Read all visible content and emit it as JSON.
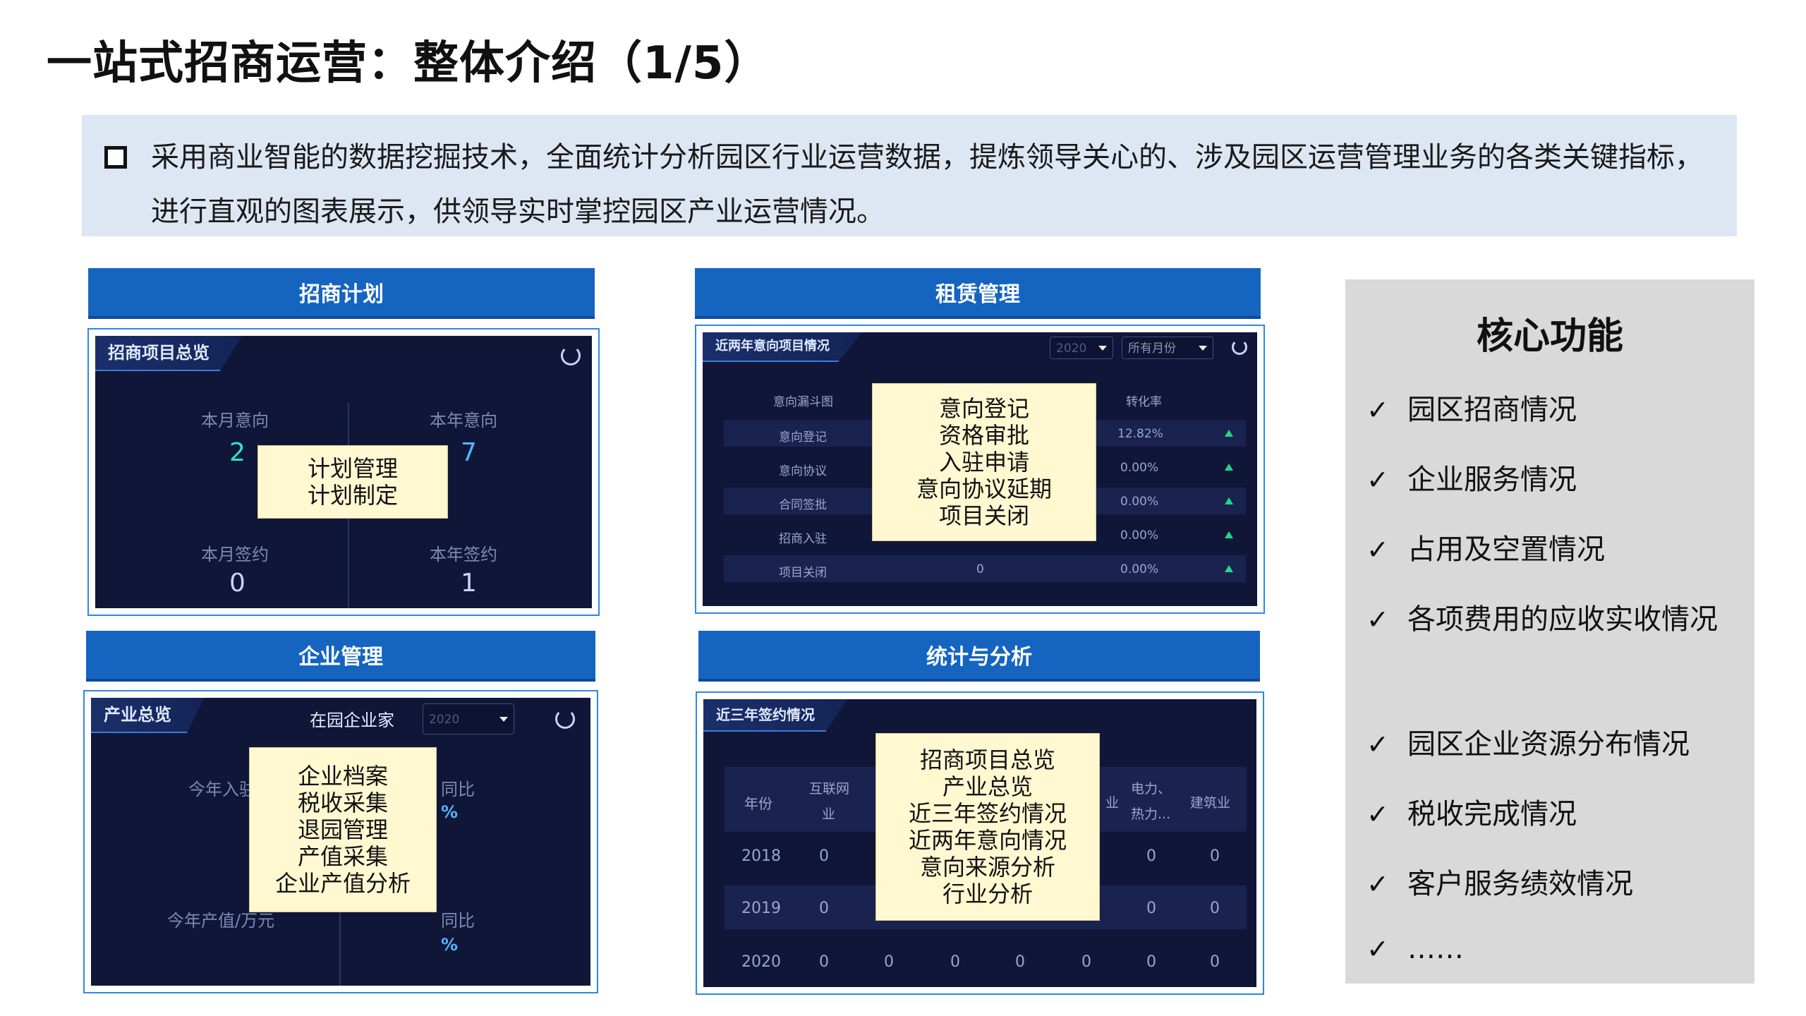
{
  "slide": {
    "title": "一站式招商运营：整体介绍（1/5）",
    "intro": "采用商业智能的数据挖掘技术，全面统计分析园区行业运营数据，提炼领导关心的、涉及园区运营管理业务的各类关键指标，进行直观的图表展示，供领导实时掌控园区产业运营情况。"
  },
  "panels": {
    "plan": {
      "header": "招商计划",
      "tab": "招商项目总览",
      "stats": [
        {
          "label": "本月意向",
          "value": "2",
          "color": "#34e0c8"
        },
        {
          "label": "本年意向",
          "value": "7",
          "color": "#4fb6ff"
        },
        {
          "label": "本月签约",
          "value": "0",
          "color": "#c9d3f0"
        },
        {
          "label": "本年签约",
          "value": "1",
          "color": "#c9d3f0"
        }
      ],
      "overlay": [
        "计划管理",
        "计划制定"
      ]
    },
    "lease": {
      "header": "租赁管理",
      "tab": "近两年意向项目情况",
      "year_select": "2020",
      "month_select": "所有月份",
      "col_funnel": "意向漏斗图",
      "col_rate": "转化率",
      "rows": [
        {
          "name": "意向登记",
          "rate": "12.82%"
        },
        {
          "name": "意向协议",
          "rate": "0.00%"
        },
        {
          "name": "合同签批",
          "rate": "0.00%"
        },
        {
          "name": "招商入驻",
          "count": "0",
          "rate": "0.00%"
        },
        {
          "name": "项目关闭",
          "count": "0",
          "rate": "0.00%"
        }
      ],
      "overlay": [
        "意向登记",
        "资格审批",
        "入驻申请",
        "意向协议延期",
        "项目关闭"
      ]
    },
    "enterprise": {
      "header": "企业管理",
      "tab": "产业总览",
      "filter_label": "在园企业家",
      "year_select": "2020",
      "label_entry": "今年入驻",
      "label_yoy1": "同比",
      "label_output": "今年产值/万元",
      "label_yoy2": "同比",
      "pct1": "%",
      "pct2": "%",
      "overlay": [
        "企业档案",
        "税收采集",
        "退园管理",
        "产值采集",
        "企业产值分析"
      ]
    },
    "stats": {
      "header": "统计与分析",
      "tab": "近三年签约情况",
      "col_year": "年份",
      "col_internet": [
        "互联网",
        "业"
      ],
      "col_partial": "业",
      "col_power": [
        "电力、",
        "热力..."
      ],
      "col_build": "建筑业",
      "rows": [
        {
          "year": "2018",
          "v1": "0",
          "v_end1": "0",
          "v_end2": "0"
        },
        {
          "year": "2019",
          "v1": "0",
          "v_end1": "0",
          "v_end2": "0"
        },
        {
          "year": "2020",
          "values": [
            "0",
            "0",
            "0",
            "0",
            "0",
            "0",
            "0"
          ]
        }
      ],
      "overlay": [
        "招商项目总览",
        "产业总览",
        "近三年签约情况",
        "近两年意向情况",
        "意向来源分析",
        "行业分析"
      ]
    }
  },
  "core": {
    "title": "核心功能",
    "check_mark": "✓",
    "items": [
      "园区招商情况",
      "企业服务情况",
      "占用及空置情况",
      "各项费用的应收实收情况",
      "园区企业资源分布情况",
      "税收完成情况",
      "客户服务绩效情况",
      "……"
    ]
  }
}
